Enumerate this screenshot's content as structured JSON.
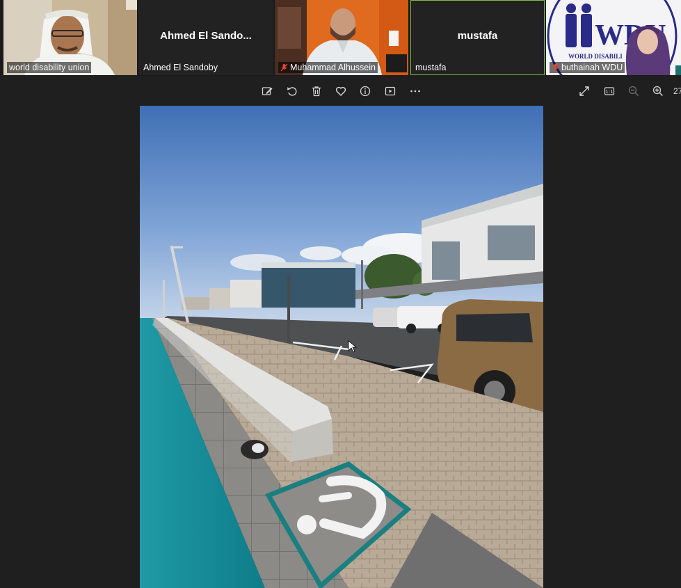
{
  "participants": [
    {
      "name": "world disability union",
      "video": true,
      "muted": false
    },
    {
      "name": "Ahmed El Sandoby",
      "display_name": "Ahmed  El  Sando...",
      "video": false,
      "muted": false
    },
    {
      "name": "Muhammad Alhussein",
      "video": true,
      "muted": true
    },
    {
      "name": "mustafa",
      "display_name": "mustafa",
      "video": false,
      "muted": false,
      "active_speaker": true
    },
    {
      "name": "buthainah WDU",
      "video": true,
      "muted": true,
      "background_logo_text": "WORLD DISABILI"
    }
  ],
  "toolbar": {
    "left_icons": [
      "edit-icon",
      "rotate-icon",
      "delete-icon",
      "favorite-icon",
      "info-icon",
      "slideshow-icon",
      "more-icon"
    ],
    "right_icons": [
      "fullscreen-icon",
      "actual-size-icon",
      "zoom-out-icon",
      "zoom-in-icon"
    ],
    "zoom_value": "27"
  },
  "photo": {
    "description_icon": "wheelchair-parking-icon"
  },
  "colors": {
    "background": "#1f1f1f",
    "active_speaker_border": "#7fbf3f",
    "muted_icon": "#e0443c"
  }
}
